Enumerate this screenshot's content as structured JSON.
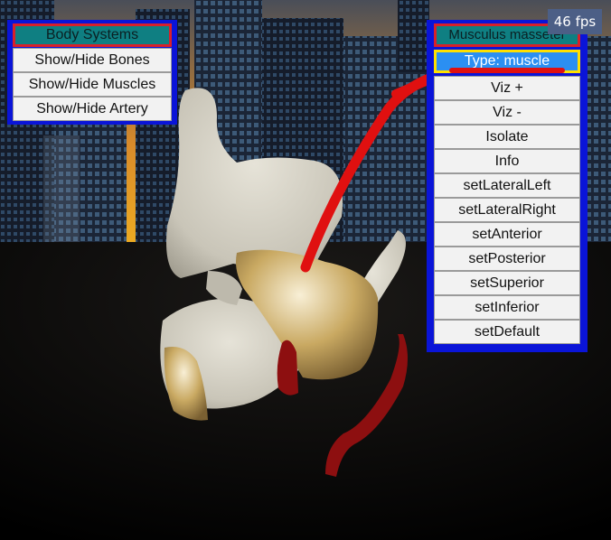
{
  "fps": "46 fps",
  "left_menu": {
    "header": "Body Systems",
    "items": [
      "Show/Hide Bones",
      "Show/Hide Muscles",
      "Show/Hide Artery"
    ]
  },
  "right_menu": {
    "header": "Musculus masseter",
    "type_label": "Type: muscle",
    "items": [
      "Viz +",
      "Viz -",
      "Isolate",
      "Info",
      "setLateralLeft",
      "setLateralRight",
      "setAnterior",
      "setPosterior",
      "setSuperior",
      "setInferior",
      "setDefault"
    ]
  },
  "colors": {
    "panel_border": "#0a14d8",
    "header_fill": "#0f7f82",
    "header_border": "#d8202a",
    "type_fill": "#2b8ff2",
    "type_border": "#ffe000",
    "annotation": "#e01010"
  }
}
